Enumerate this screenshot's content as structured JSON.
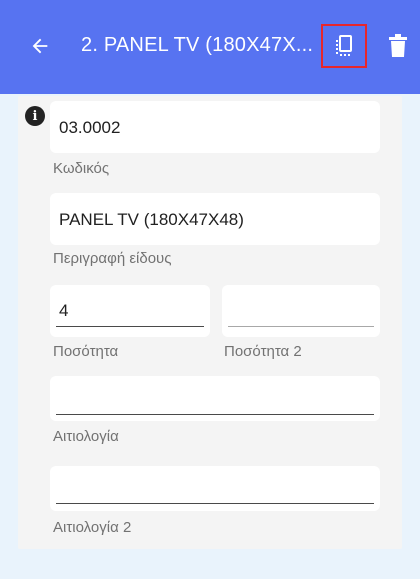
{
  "appbar": {
    "title": "2. PANEL TV (180X47X...",
    "icons": {
      "back": "arrow-back-icon",
      "copy": "copy-icon",
      "delete": "trash-icon"
    }
  },
  "form": {
    "code": {
      "value": "03.0002",
      "label": "Κωδικός"
    },
    "description": {
      "value": "PANEL TV (180X47X48)",
      "label": "Περιγραφή είδους"
    },
    "quantity": {
      "value": "4",
      "label": "Ποσότητα"
    },
    "quantity2": {
      "value": "",
      "label": "Ποσότητα 2"
    },
    "reason": {
      "value": "",
      "label": "Αιτιολογία"
    },
    "reason2": {
      "value": "",
      "label": "Αιτιολογία 2"
    }
  },
  "colors": {
    "appbar": "#5773f1",
    "highlight": "#e8262c",
    "background": "#e9f3fc"
  }
}
